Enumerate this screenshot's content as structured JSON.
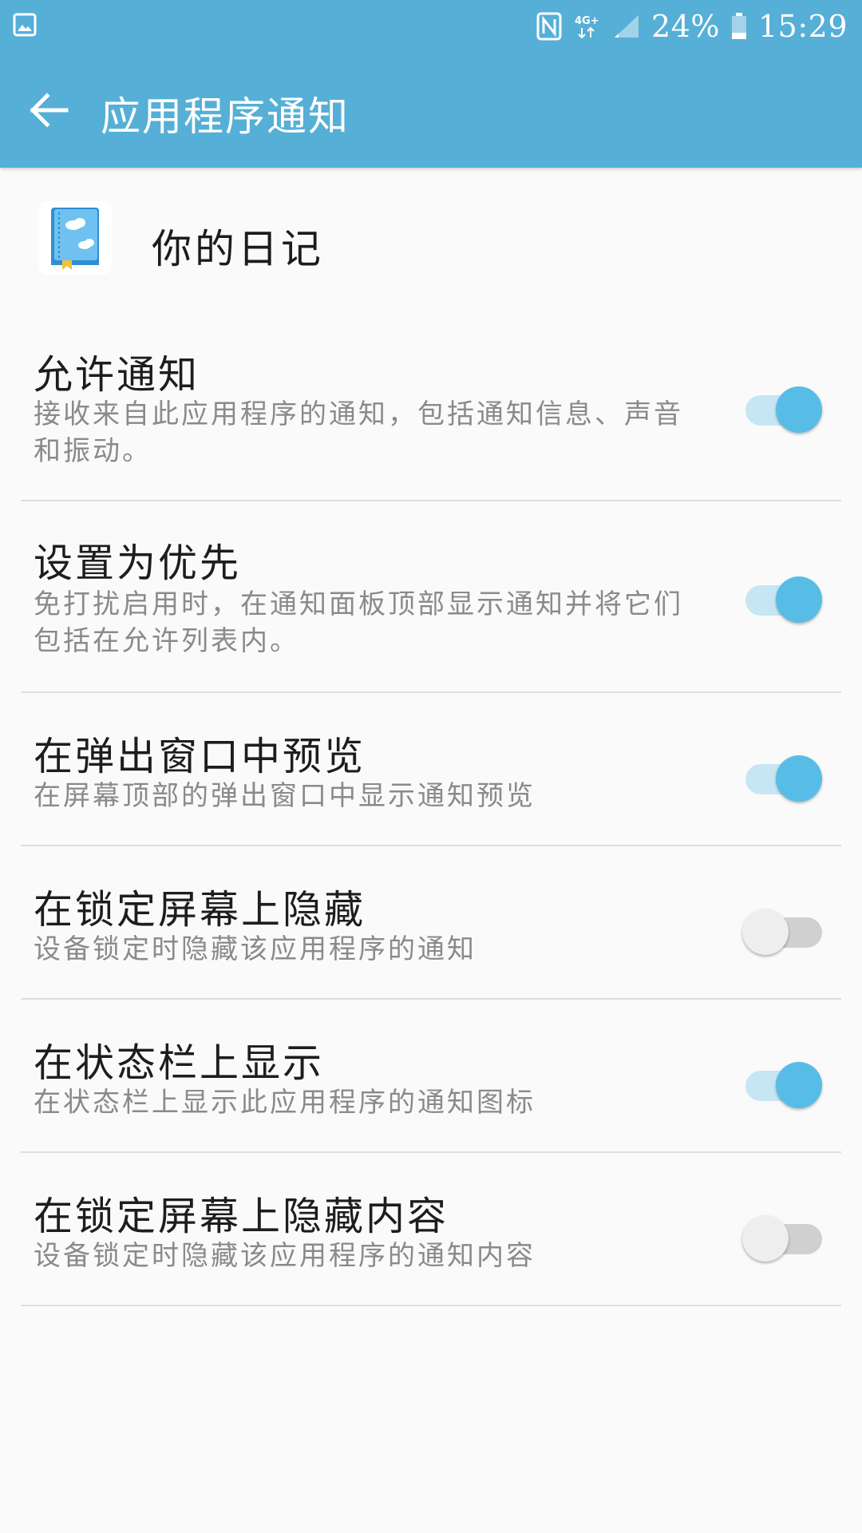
{
  "status_bar": {
    "left_icon": "image-icon",
    "nfc_icon": "nfc-icon",
    "network_label": "4G+",
    "signal_icon": "signal-icon",
    "battery_percent": "24%",
    "battery_icon": "battery-icon",
    "time": "15:29"
  },
  "app_bar": {
    "back_icon": "arrow-left-icon",
    "title": "应用程序通知"
  },
  "app": {
    "icon": "diary-book-icon",
    "name": "你的日记"
  },
  "settings": [
    {
      "title": "允许通知",
      "description": "接收来自此应用程序的通知，包括通知信息、声音和振动。",
      "enabled": true
    },
    {
      "title": "设置为优先",
      "description": "免打扰启用时，在通知面板顶部显示通知并将它们包括在允许列表内。",
      "enabled": true
    },
    {
      "title": "在弹出窗口中预览",
      "description": "在屏幕顶部的弹出窗口中显示通知预览",
      "enabled": true
    },
    {
      "title": "在锁定屏幕上隐藏",
      "description": "设备锁定时隐藏该应用程序的通知",
      "enabled": false
    },
    {
      "title": "在状态栏上显示",
      "description": "在状态栏上显示此应用程序的通知图标",
      "enabled": true
    },
    {
      "title": "在锁定屏幕上隐藏内容",
      "description": "设备锁定时隐藏该应用程序的通知内容",
      "enabled": false
    }
  ],
  "colors": {
    "primary": "#56afd6",
    "toggle_on_knob": "#57bde6",
    "toggle_on_track": "#c6e6f3",
    "toggle_off_knob": "#eeeeee",
    "toggle_off_track": "#d0d0d0"
  }
}
